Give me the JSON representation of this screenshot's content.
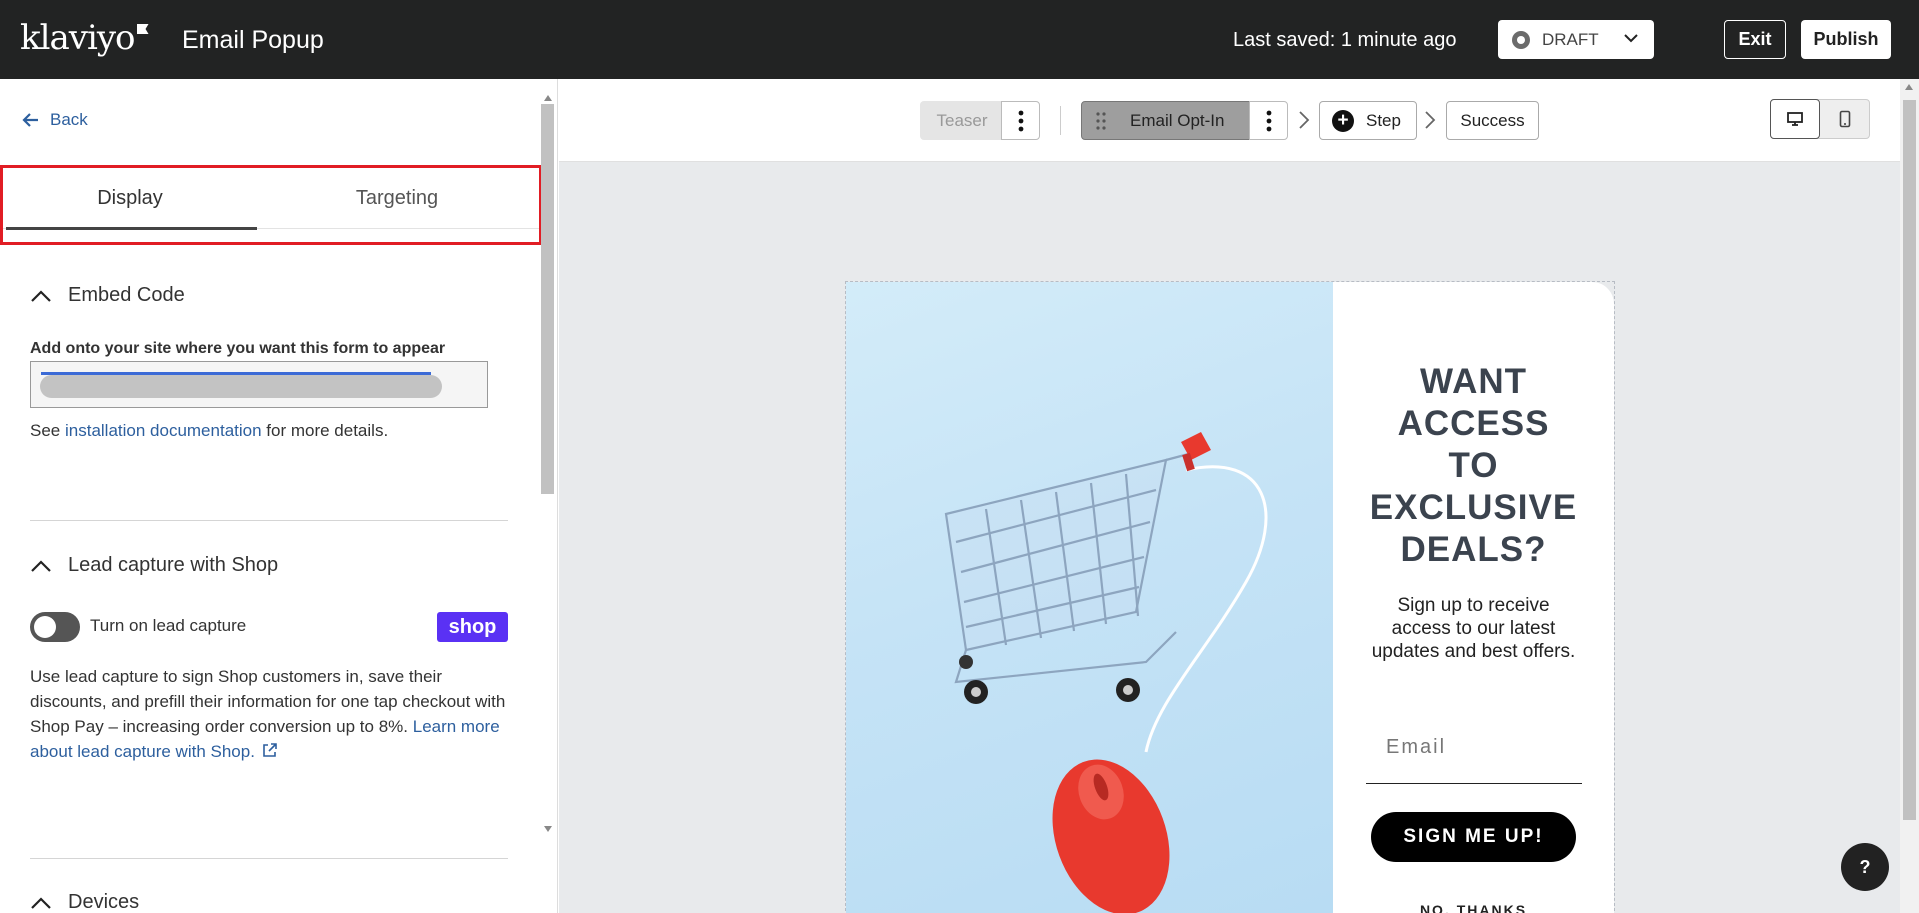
{
  "header": {
    "logo": "klaviyo",
    "title": "Email Popup",
    "last_saved": "Last saved: 1 minute ago",
    "status": "DRAFT",
    "exit_label": "Exit",
    "publish_label": "Publish"
  },
  "sidebar": {
    "back_label": "Back",
    "tabs": [
      {
        "label": "Display",
        "active": true
      },
      {
        "label": "Targeting",
        "active": false
      }
    ],
    "embed": {
      "heading": "Embed Code",
      "label": "Add onto your site where you want this form to appear",
      "see_prefix": "See ",
      "see_link": "installation documentation",
      "see_suffix": " for more details."
    },
    "lead_capture": {
      "heading": "Lead capture with Shop",
      "toggle_label": "Turn on lead capture",
      "toggle_on": false,
      "badge": "shop",
      "description": "Use lead capture to sign Shop customers in, save their discounts, and prefill their information for one tap checkout with Shop Pay – increasing order conversion up to 8%. ",
      "link": "Learn more about lead capture with Shop."
    },
    "devices": {
      "heading": "Devices"
    }
  },
  "steps": {
    "teaser": "Teaser",
    "optin": "Email Opt-In",
    "add_step": "Step",
    "success": "Success"
  },
  "popup": {
    "headline_lines": [
      "WANT",
      "ACCESS",
      "TO",
      "EXCLUSIVE",
      "DEALS?"
    ],
    "subtext": "Sign up to receive access to our latest updates and best offers.",
    "email_placeholder": "Email",
    "cta": "SIGN ME UP!",
    "no_thanks": "NO, THANKS"
  },
  "help_label": "?",
  "colors": {
    "topbar": "#222323",
    "link": "#2d5f9e",
    "shop_brand": "#5a31f4",
    "highlight": "#e11d24",
    "headline": "#3b434e",
    "cart_mouse": "#e8392e"
  }
}
